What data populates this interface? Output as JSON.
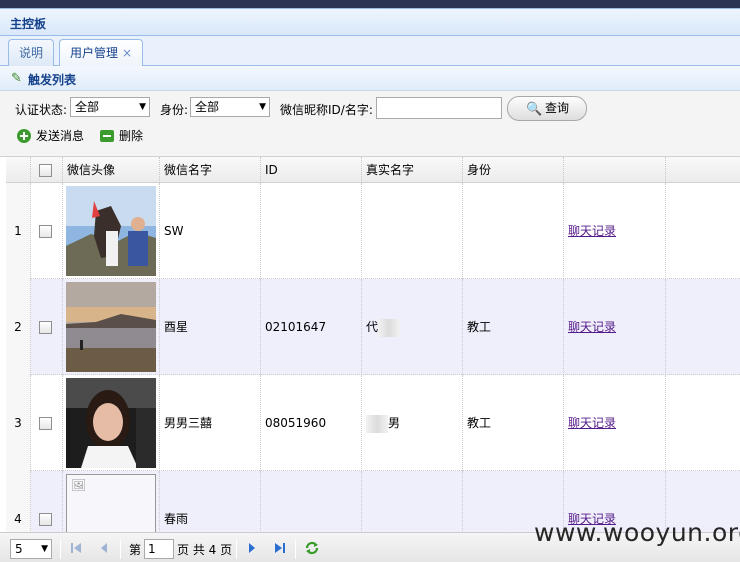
{
  "panel": {
    "title": "主控板"
  },
  "tabs": [
    {
      "label": "说明"
    },
    {
      "label": "用户管理",
      "close": "×"
    }
  ],
  "grid_title": "触发列表",
  "filters": {
    "auth_label": "认证状态:",
    "auth_value": "全部",
    "identity_label": "身份:",
    "identity_value": "全部",
    "name_label": "微信昵称ID/名字:",
    "name_value": "",
    "query_label": "查询"
  },
  "actions": {
    "send": "发送消息",
    "delete": "删除"
  },
  "columns": [
    "微信头像",
    "微信名字",
    "ID",
    "真实名字",
    "身份",
    ""
  ],
  "rows": [
    {
      "num": "1",
      "name": "SW",
      "id": "",
      "real_pre": "",
      "real_post": "",
      "identity": "",
      "action": "聊天记录"
    },
    {
      "num": "2",
      "name": "酉星",
      "id": "02101647",
      "real_pre": "代",
      "real_post": "辉",
      "identity": "教工",
      "action": "聊天记录"
    },
    {
      "num": "3",
      "name": "男男三囍",
      "id": "08051960",
      "real_pre": "张",
      "real_post": "男",
      "identity": "教工",
      "action": "聊天记录"
    },
    {
      "num": "4",
      "name": "春雨",
      "id": "",
      "real_pre": "",
      "real_post": "",
      "identity": "",
      "action": "聊天记录"
    }
  ],
  "pager": {
    "page_size": "5",
    "page_prefix": "第",
    "page": "1",
    "page_suffix": "页 共 4 页"
  },
  "watermark": "www.wooyun.org"
}
